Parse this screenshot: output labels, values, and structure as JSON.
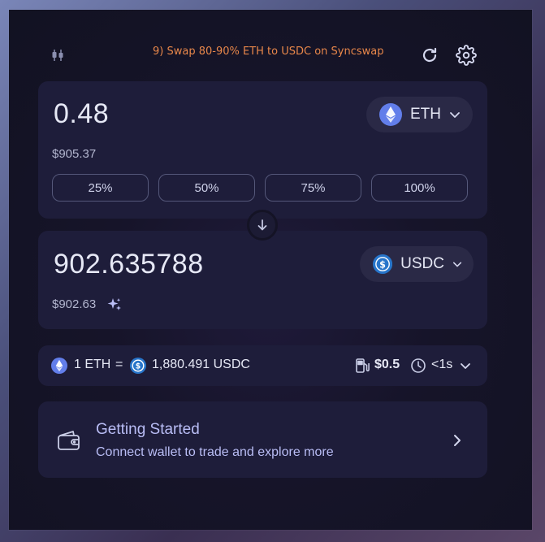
{
  "header": {
    "note": "9) Swap 80-90% ETH to USDC on Syncswap",
    "left_icon": "chart-candles-icon",
    "refresh_icon": "refresh-icon",
    "settings_icon": "gear-icon"
  },
  "from": {
    "amount": "0.48",
    "usd_value": "$905.37",
    "token": "ETH",
    "percentages": [
      "25%",
      "50%",
      "75%",
      "100%"
    ]
  },
  "to": {
    "amount": "902.635788",
    "usd_value": "$902.63",
    "token": "USDC"
  },
  "rate": {
    "left": "1 ETH",
    "equals": "=",
    "right": "1,880.491 USDC",
    "gas": "$0.5",
    "time": "<1s"
  },
  "getting_started": {
    "title": "Getting Started",
    "subtitle": "Connect wallet to trade and explore more"
  },
  "colors": {
    "accent": "#b9bdf5",
    "note": "#e8874a",
    "card": "#1e1d3a",
    "eth": "#627eea",
    "usdc": "#2775ca"
  }
}
